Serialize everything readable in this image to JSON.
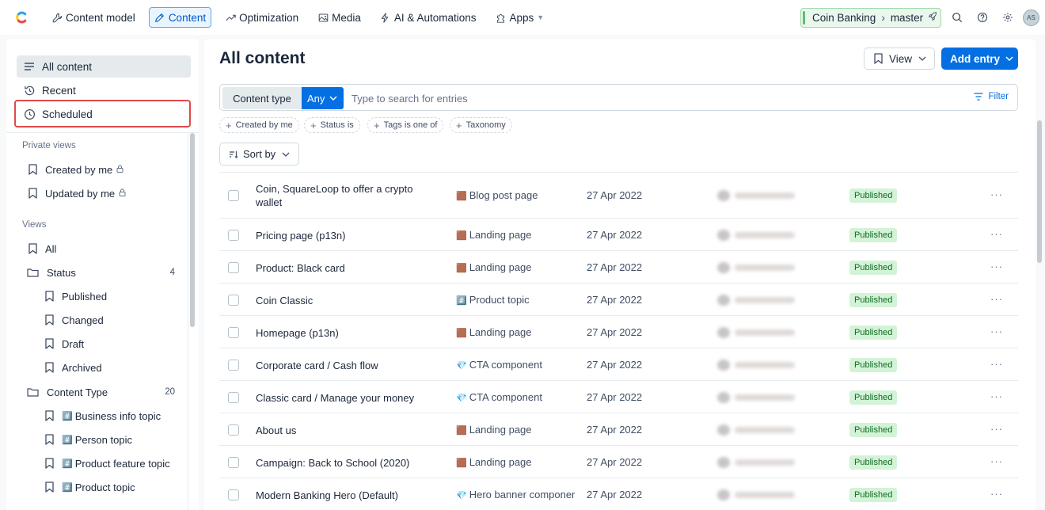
{
  "nav": {
    "items": [
      {
        "label": "Content model",
        "icon": "wrench-icon"
      },
      {
        "label": "Content",
        "icon": "pen-icon",
        "active": true
      },
      {
        "label": "Optimization",
        "icon": "trend-icon"
      },
      {
        "label": "Media",
        "icon": "image-icon"
      },
      {
        "label": "AI & Automations",
        "icon": "bolt-icon"
      },
      {
        "label": "Apps",
        "icon": "puzzle-icon"
      }
    ],
    "space": "Coin Banking",
    "environment": "master",
    "avatar": "AS"
  },
  "sidebar": {
    "top": [
      {
        "label": "All content",
        "icon": "list-icon"
      },
      {
        "label": "Recent",
        "icon": "history-icon"
      },
      {
        "label": "Scheduled",
        "icon": "clock-icon"
      }
    ],
    "private_heading": "Private views",
    "private": [
      {
        "label": "Created by me"
      },
      {
        "label": "Updated by me"
      }
    ],
    "views_heading": "Views",
    "views": [
      {
        "label": "All",
        "icon": "bookmark-icon"
      },
      {
        "label": "Status",
        "icon": "folder-icon",
        "count": "4"
      },
      {
        "label": "Published",
        "icon": "bookmark-icon"
      },
      {
        "label": "Changed",
        "icon": "bookmark-icon"
      },
      {
        "label": "Draft",
        "icon": "bookmark-icon"
      },
      {
        "label": "Archived",
        "icon": "bookmark-icon"
      },
      {
        "label": "Content Type",
        "icon": "folder-icon",
        "count": "20"
      },
      {
        "label": "Business info topic",
        "icon": "bookmark-icon",
        "emoji": "#️⃣"
      },
      {
        "label": "Person topic",
        "icon": "bookmark-icon",
        "emoji": "#️⃣"
      },
      {
        "label": "Product feature topic",
        "icon": "bookmark-icon",
        "emoji": "#️⃣"
      },
      {
        "label": "Product topic",
        "icon": "bookmark-icon",
        "emoji": "#️⃣"
      }
    ]
  },
  "main": {
    "title": "All content",
    "view_label": "View",
    "add_label": "Add entry",
    "content_type_label": "Content type",
    "content_type_value": "Any",
    "search_placeholder": "Type to search for entries",
    "filter_label": "Filter",
    "chips": [
      "Created by me",
      "Status is",
      "Tags is one of",
      "Taxonomy"
    ],
    "sort_label": "Sort by"
  },
  "entries": [
    {
      "title": "Coin, SquareLoop to offer a crypto wallet",
      "type_emoji": "🟫",
      "type": "Blog post page",
      "date": "27 Apr 2022",
      "status": "Published"
    },
    {
      "title": "Pricing page (p13n)",
      "type_emoji": "🟫",
      "type": "Landing page",
      "date": "27 Apr 2022",
      "status": "Published"
    },
    {
      "title": "Product: Black card",
      "type_emoji": "🟫",
      "type": "Landing page",
      "date": "27 Apr 2022",
      "status": "Published"
    },
    {
      "title": "Coin Classic",
      "type_emoji": "#️⃣",
      "type": "Product topic",
      "date": "27 Apr 2022",
      "status": "Published"
    },
    {
      "title": "Homepage (p13n)",
      "type_emoji": "🟫",
      "type": "Landing page",
      "date": "27 Apr 2022",
      "status": "Published"
    },
    {
      "title": "Corporate card / Cash flow",
      "type_emoji": "💎",
      "type": "CTA component",
      "date": "27 Apr 2022",
      "status": "Published"
    },
    {
      "title": "Classic card / Manage your money",
      "type_emoji": "💎",
      "type": "CTA component",
      "date": "27 Apr 2022",
      "status": "Published"
    },
    {
      "title": "About us",
      "type_emoji": "🟫",
      "type": "Landing page",
      "date": "27 Apr 2022",
      "status": "Published"
    },
    {
      "title": "Campaign: Back to School (2020)",
      "type_emoji": "🟫",
      "type": "Landing page",
      "date": "27 Apr 2022",
      "status": "Published"
    },
    {
      "title": "Modern Banking Hero (Default)",
      "type_emoji": "💎",
      "type": "Hero banner componer",
      "date": "27 Apr 2022",
      "status": "Published"
    }
  ],
  "colors": {
    "accent": "#036fe3",
    "published_bg": "#d3f3d7",
    "published_text": "#0f6b22",
    "highlight": "#e04a4a",
    "env_badge_bg": "#eaf7ec"
  }
}
